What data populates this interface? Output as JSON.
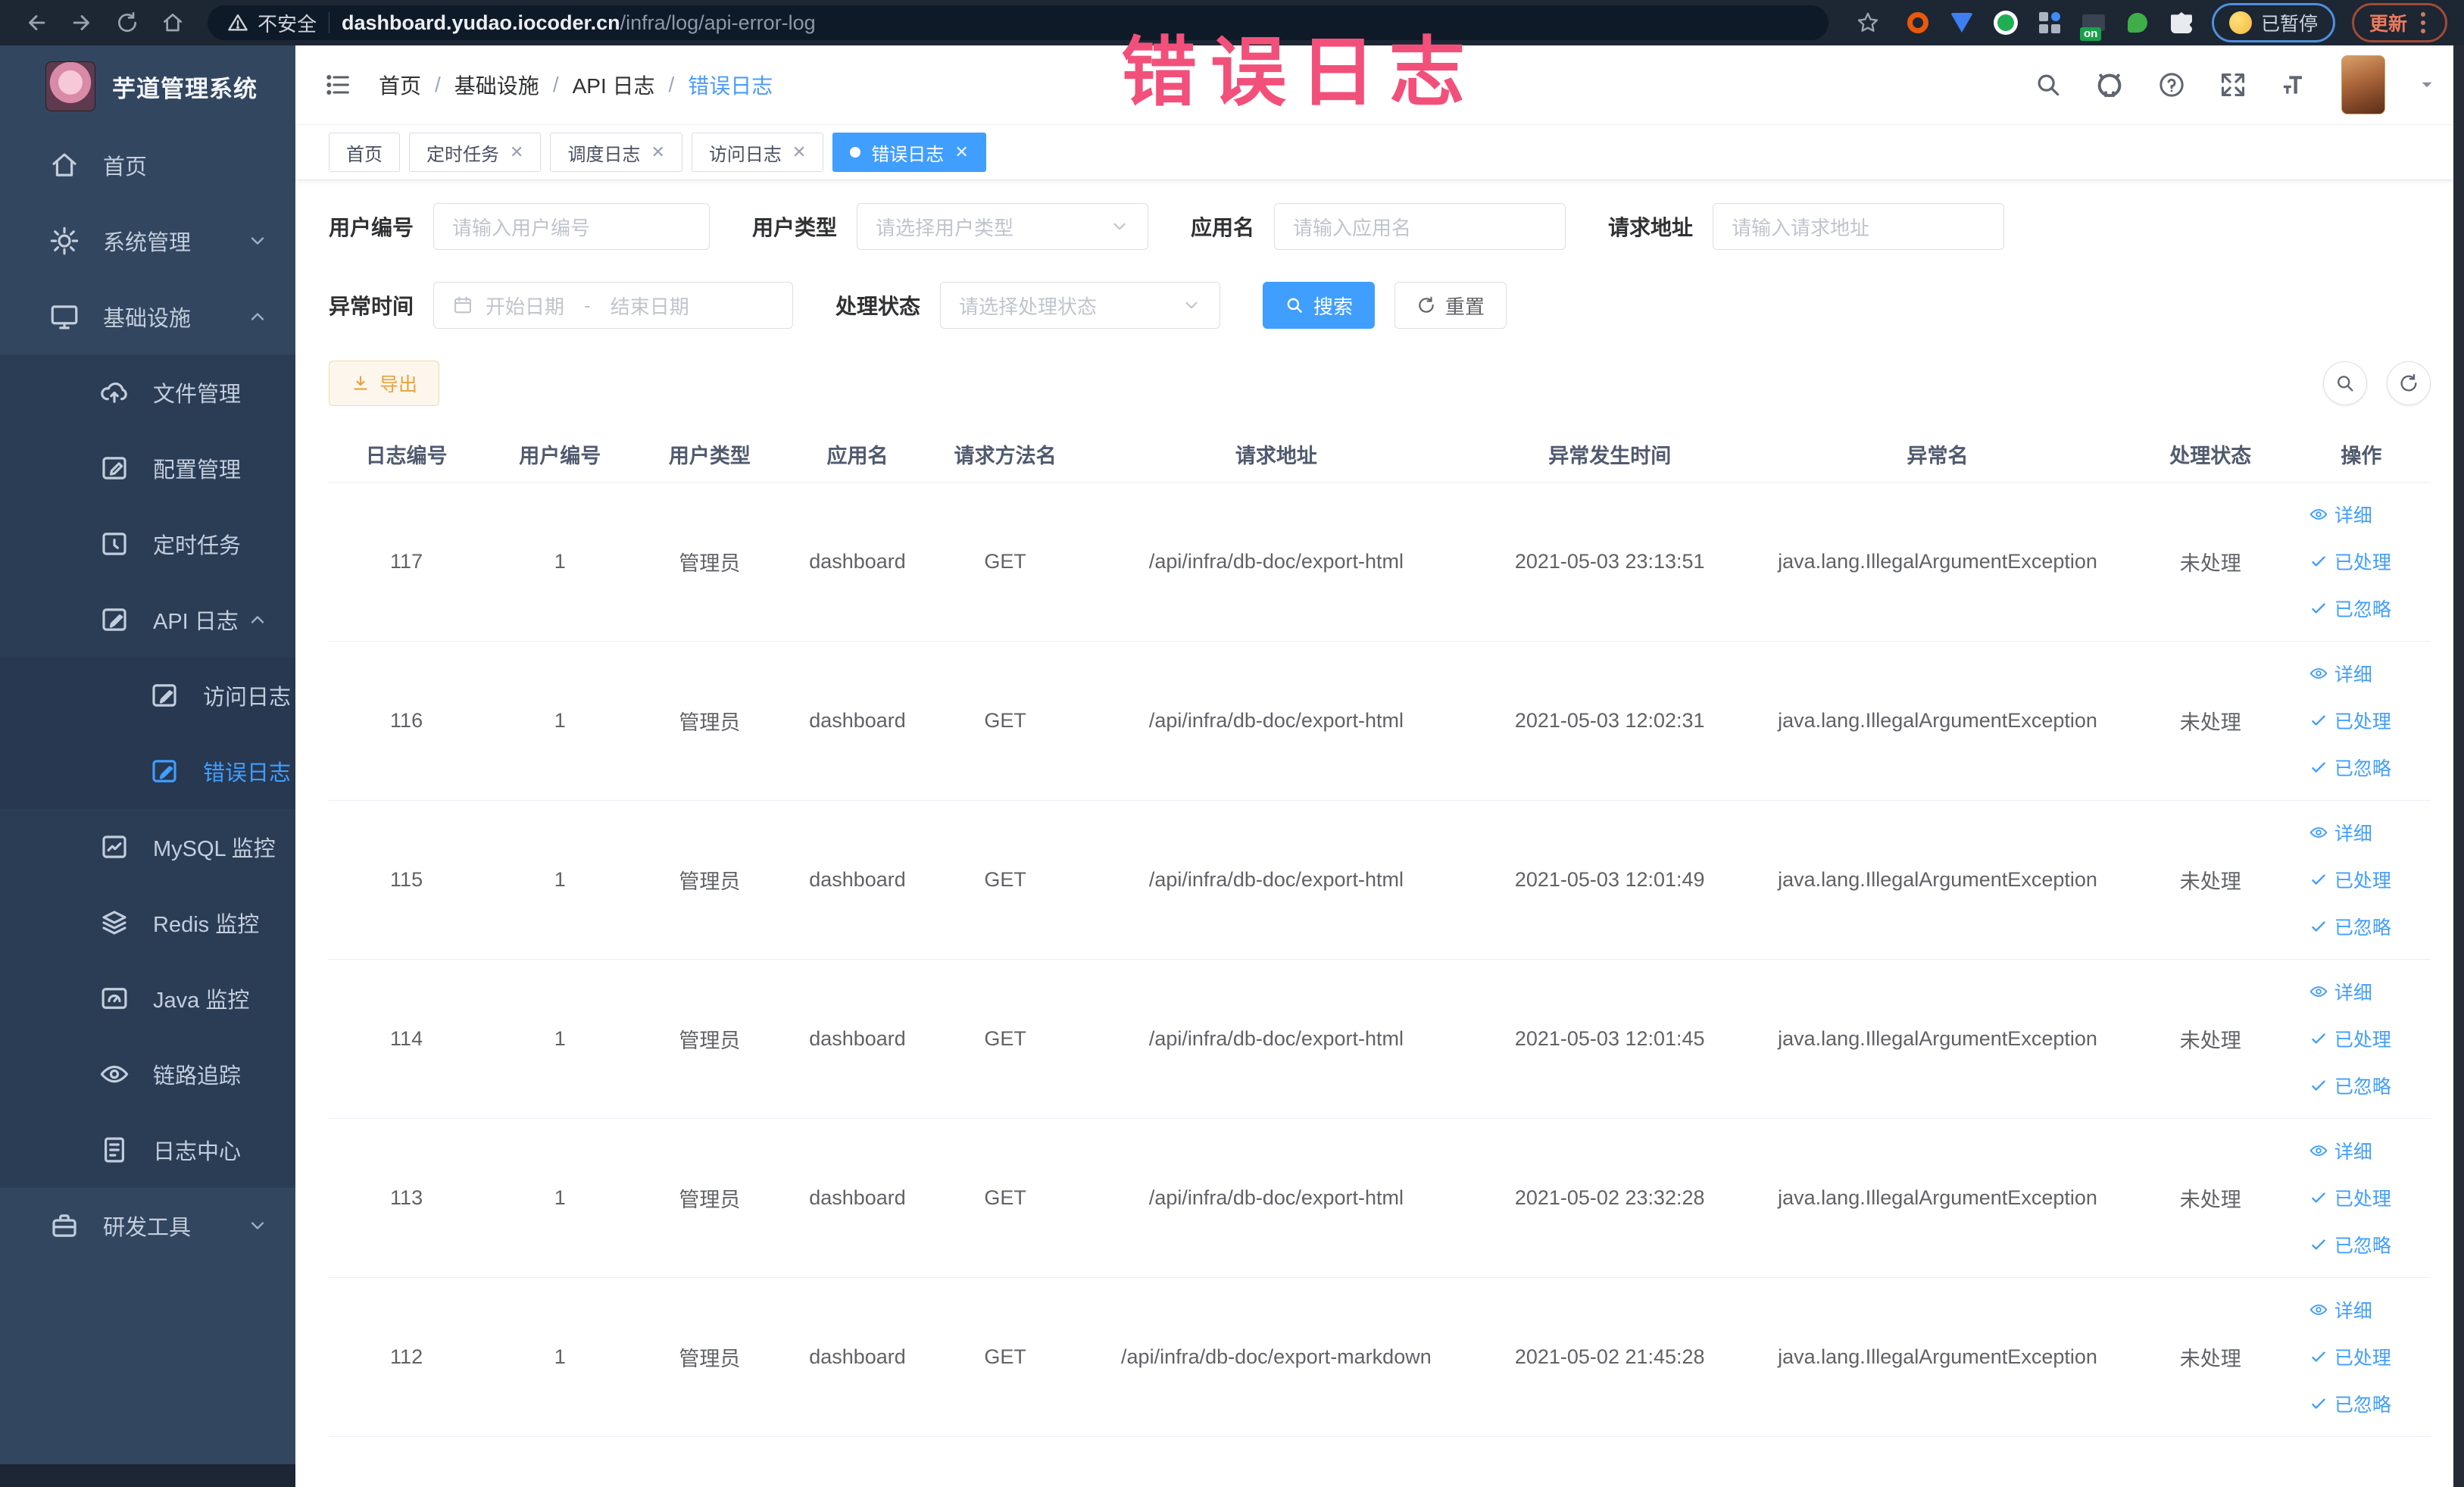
{
  "browser": {
    "security_label": "不安全",
    "url_domain": "dashboard.yudao.iocoder.cn",
    "url_path": "/infra/log/api-error-log",
    "ext_on_badge": "on",
    "paused_badge": "已暂停",
    "update_badge": "更新"
  },
  "annotation": "错误日志",
  "sidebar": {
    "title": "芋道管理系统",
    "items": {
      "home": "首页",
      "system": "系统管理",
      "infra": "基础设施",
      "file": "文件管理",
      "config": "配置管理",
      "job": "定时任务",
      "api_log": "API 日志",
      "access_log": "访问日志",
      "error_log": "错误日志",
      "mysql": "MySQL 监控",
      "redis": "Redis 监控",
      "java": "Java 监控",
      "trace": "链路追踪",
      "log_center": "日志中心",
      "dev_tools": "研发工具"
    }
  },
  "breadcrumb": {
    "separator": "/",
    "b0": "首页",
    "b1": "基础设施",
    "b2": "API 日志",
    "b3": "错误日志"
  },
  "tabs": {
    "t0": "首页",
    "t1": "定时任务",
    "t2": "调度日志",
    "t3": "访问日志",
    "t4": "错误日志"
  },
  "filters": {
    "user_id_label": "用户编号",
    "user_id_placeholder": "请输入用户编号",
    "user_type_label": "用户类型",
    "user_type_placeholder": "请选择用户类型",
    "app_name_label": "应用名",
    "app_name_placeholder": "请输入应用名",
    "request_url_label": "请求地址",
    "request_url_placeholder": "请输入请求地址",
    "exception_time_label": "异常时间",
    "date_start_placeholder": "开始日期",
    "date_separator": "-",
    "date_end_placeholder": "结束日期",
    "process_status_label": "处理状态",
    "process_status_placeholder": "请选择处理状态",
    "search_button": "搜索",
    "reset_button": "重置"
  },
  "toolbar": {
    "export_button": "导出"
  },
  "table": {
    "columns": [
      "日志编号",
      "用户编号",
      "用户类型",
      "应用名",
      "请求方法名",
      "请求地址",
      "异常发生时间",
      "异常名",
      "处理状态",
      "操作"
    ],
    "actions": [
      "详细",
      "已处理",
      "已忽略"
    ],
    "rows": [
      {
        "id": "117",
        "user_id": "1",
        "user_type": "管理员",
        "app": "dashboard",
        "method": "GET",
        "url": "/api/infra/db-doc/export-html",
        "time": "2021-05-03 23:13:51",
        "exception": "java.lang.IllegalArgumentException",
        "status": "未处理"
      },
      {
        "id": "116",
        "user_id": "1",
        "user_type": "管理员",
        "app": "dashboard",
        "method": "GET",
        "url": "/api/infra/db-doc/export-html",
        "time": "2021-05-03 12:02:31",
        "exception": "java.lang.IllegalArgumentException",
        "status": "未处理"
      },
      {
        "id": "115",
        "user_id": "1",
        "user_type": "管理员",
        "app": "dashboard",
        "method": "GET",
        "url": "/api/infra/db-doc/export-html",
        "time": "2021-05-03 12:01:49",
        "exception": "java.lang.IllegalArgumentException",
        "status": "未处理"
      },
      {
        "id": "114",
        "user_id": "1",
        "user_type": "管理员",
        "app": "dashboard",
        "method": "GET",
        "url": "/api/infra/db-doc/export-html",
        "time": "2021-05-03 12:01:45",
        "exception": "java.lang.IllegalArgumentException",
        "status": "未处理"
      },
      {
        "id": "113",
        "user_id": "1",
        "user_type": "管理员",
        "app": "dashboard",
        "method": "GET",
        "url": "/api/infra/db-doc/export-html",
        "time": "2021-05-02 23:32:28",
        "exception": "java.lang.IllegalArgumentException",
        "status": "未处理"
      },
      {
        "id": "112",
        "user_id": "1",
        "user_type": "管理员",
        "app": "dashboard",
        "method": "GET",
        "url": "/api/infra/db-doc/export-markdown",
        "time": "2021-05-02 21:45:28",
        "exception": "java.lang.IllegalArgumentException",
        "status": "未处理"
      }
    ]
  }
}
